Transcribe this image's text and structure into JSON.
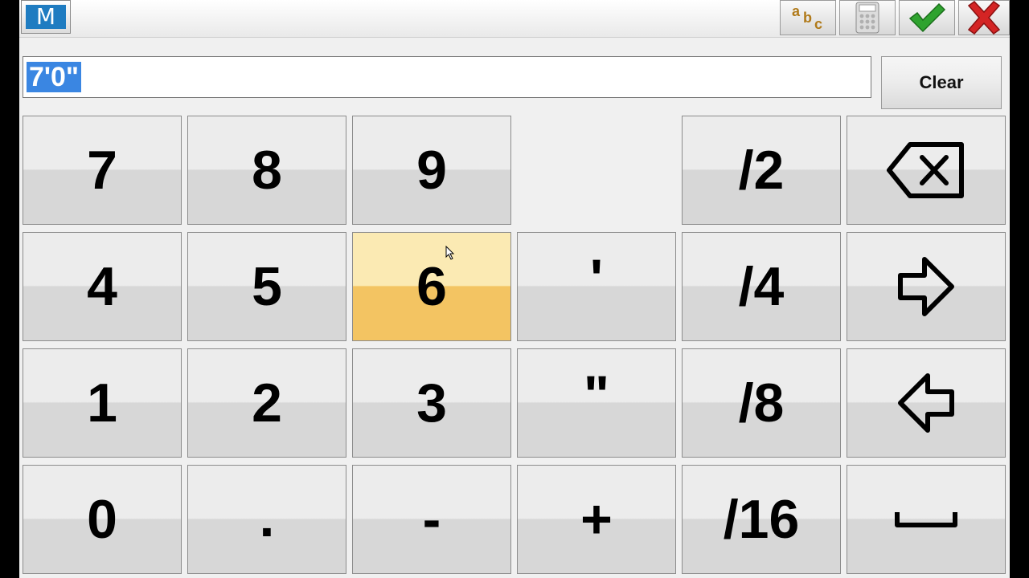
{
  "topbar": {
    "logo_letter": "M",
    "abc_letters": [
      "a",
      "b",
      "c"
    ],
    "colors": {
      "logo_blue": "#1f7cc1",
      "check_green": "#2fa32f",
      "close_red": "#d42424"
    }
  },
  "input": {
    "value": "7'0\""
  },
  "clear_label": "Clear",
  "keys": {
    "k7": "7",
    "k8": "8",
    "k9": "9",
    "half": "/2",
    "k4": "4",
    "k5": "5",
    "k6": "6",
    "feet": "'",
    "quarter": "/4",
    "k1": "1",
    "k2": "2",
    "k3": "3",
    "inch": "\"",
    "eighth": "/8",
    "k0": "0",
    "dot": ".",
    "minus": "-",
    "plus": "+",
    "sixteenth": "/16"
  },
  "icons": {
    "backspace": "backspace-icon",
    "right": "arrow-right-icon",
    "left": "arrow-left-icon",
    "space": "space-bar-icon"
  },
  "highlight_color": "#f3c462"
}
